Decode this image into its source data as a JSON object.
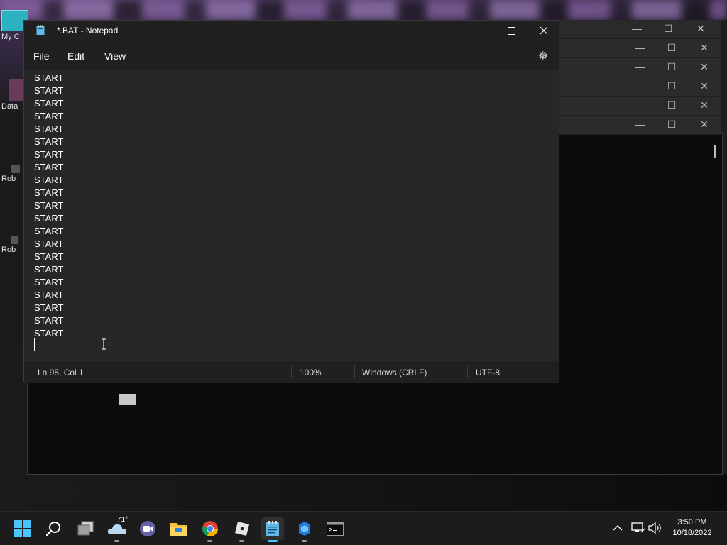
{
  "desktop": {
    "icons": [
      {
        "label": "My C"
      },
      {
        "label": "Data"
      },
      {
        "label": "Rob"
      },
      {
        "label": "Rob"
      }
    ]
  },
  "notepad": {
    "title": "*.BAT - Notepad",
    "menu": {
      "file": "File",
      "edit": "Edit",
      "view": "View"
    },
    "lines": [
      "START",
      "START",
      "START",
      "START",
      "START",
      "START",
      "START",
      "START",
      "START",
      "START",
      "START",
      "START",
      "START",
      "START",
      "START",
      "START",
      "START",
      "START",
      "START",
      "START",
      "START"
    ],
    "status": {
      "position": "Ln 95, Col 1",
      "zoom": "100%",
      "line_ending": "Windows (CRLF)",
      "encoding": "UTF-8"
    }
  },
  "taskbar": {
    "weather_temp": "71°",
    "time": "3:50 PM",
    "date": "10/18/2022"
  },
  "colors": {
    "accent": "#4cc2ff",
    "notepad_bg": "#272727",
    "titlebar_bg": "#202020"
  }
}
